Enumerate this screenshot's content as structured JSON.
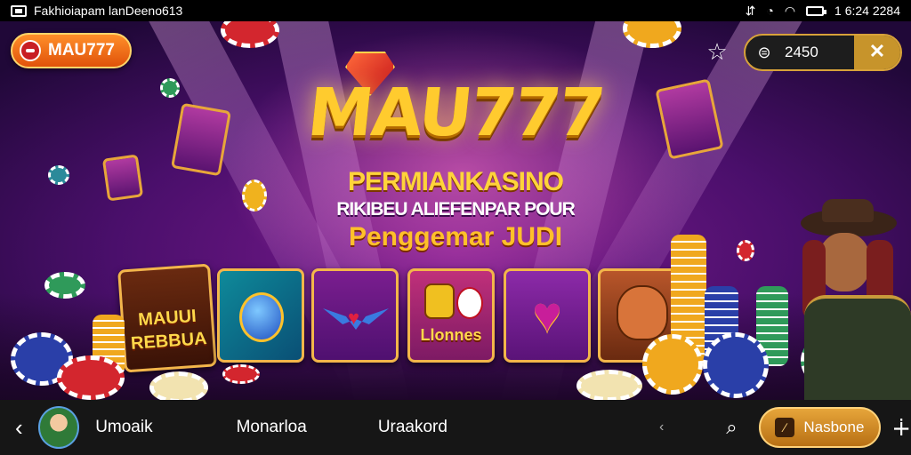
{
  "status_bar": {
    "title": "Fakhioiapam lanDeeno613",
    "time": "1 6:24 2284",
    "icons": [
      "screen-icon",
      "vibrate-icon",
      "alarm-icon",
      "wifi-icon",
      "battery-icon"
    ]
  },
  "header": {
    "brand_label": "MAU777",
    "coin_value": "2450",
    "icons": [
      "brand-logo-icon",
      "star-icon",
      "coin-icon",
      "close-icon"
    ]
  },
  "banner": {
    "logo": "MAU777",
    "line1": "PERMIANKASINO",
    "line2": "RIKIBEU ALIEFENPAR POUR",
    "line3": "Penggemar JUDI"
  },
  "tiles": [
    {
      "label": "MAUUI",
      "label2": "REBBUA",
      "name": "game-tile-maui"
    },
    {
      "label": "",
      "name": "game-tile-blue-orb"
    },
    {
      "label": "",
      "name": "game-tile-winged-heart"
    },
    {
      "label": "Llonnes",
      "name": "game-tile-llonnes"
    },
    {
      "label": "",
      "name": "game-tile-purple-heart"
    },
    {
      "label": "",
      "name": "game-tile-cat"
    }
  ],
  "nav": {
    "items": [
      {
        "label": "Umoaik"
      },
      {
        "label": "Monarloa"
      },
      {
        "label": "Uraakord"
      }
    ],
    "cta_label": "Nasbone",
    "icons": [
      "back-icon",
      "avatar",
      "chevron-icon",
      "search-icon",
      "cta-icon",
      "plus-icon"
    ]
  },
  "colors": {
    "accent_gold": "#f3b64a",
    "brand_orange": "#e0520a",
    "stage_purple": "#7a1a8e",
    "nav_bg": "#161616"
  }
}
